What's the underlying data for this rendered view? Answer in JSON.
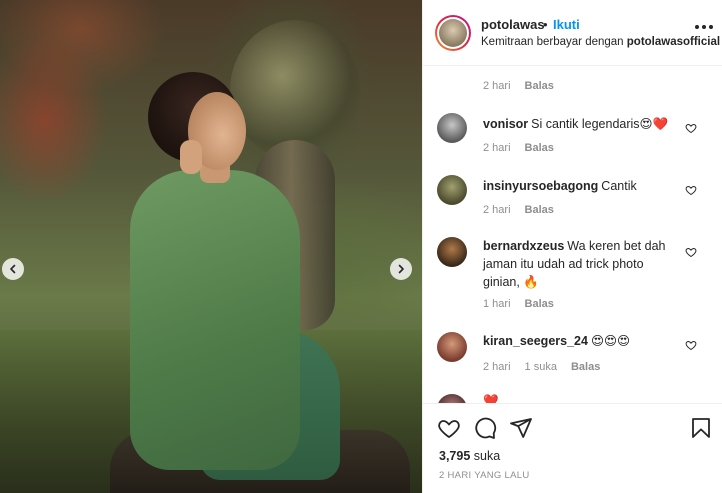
{
  "post": {
    "photo_alt": "",
    "prev_label": "‹",
    "next_label": "›"
  },
  "header": {
    "username": "potolawas",
    "dot": "•",
    "follow_label": "Ikuti",
    "subtitle_prefix": "Kemitraan berbayar dengan ",
    "subtitle_partner": "potolawasofficial",
    "more_icon": "more-horizontal-icon"
  },
  "comments": [
    {
      "meta_only": true,
      "time": "2 hari",
      "reply_label": "Balas"
    },
    {
      "username": "vonisor",
      "text": "Si cantik legendaris😍❤️",
      "time": "2 hari",
      "reply_label": "Balas"
    },
    {
      "username": "insinyursoebagong",
      "text": "Cantik",
      "time": "2 hari",
      "reply_label": "Balas"
    },
    {
      "username": "bernardxzeus",
      "text": "Wa keren bet dah jaman itu udah ad trick photo ginian, 🔥",
      "time": "1 hari",
      "reply_label": "Balas"
    },
    {
      "username": "kiran_seegers_24",
      "text": "😍😍😍",
      "time": "2 hari",
      "likes": "1 suka",
      "reply_label": "Balas"
    },
    {
      "username": "",
      "text": "❤️",
      "partial": true
    }
  ],
  "actions": {
    "like_icon": "heart-icon",
    "comment_icon": "comment-icon",
    "share_icon": "send-icon",
    "save_icon": "bookmark-icon",
    "likes_count": "3,795",
    "likes_label": "suka",
    "posted": "2 HARI YANG LALU"
  },
  "colors": {
    "accent": "#0095f6",
    "text": "#262626",
    "muted": "#8e8e8e",
    "heart": "#ed4956"
  }
}
